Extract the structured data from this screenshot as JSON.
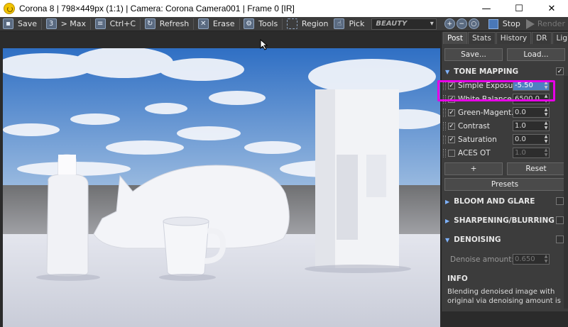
{
  "window": {
    "title": "Corona 8 | 798×449px (1:1) | Camera: Corona Camera001 | Frame 0 [IR]",
    "minimize": "—",
    "maximize": "☐",
    "close": "✕"
  },
  "toolbar": {
    "save": "Save",
    "max": "> Max",
    "copy": "Ctrl+C",
    "refresh": "Refresh",
    "erase": "Erase",
    "tools": "Tools",
    "region": "Region",
    "pick": "Pick",
    "channel": "BEAUTY",
    "stop": "Stop",
    "render": "Render"
  },
  "tabs": [
    "Post",
    "Stats",
    "History",
    "DR",
    "LightMix"
  ],
  "panel": {
    "save": "Save...",
    "load": "Load...",
    "tone_mapping": "TONE MAPPING",
    "rows": [
      {
        "label": "Simple Exposure",
        "value": "-5.50"
      },
      {
        "label": "White Balance",
        "value": "6500.0"
      },
      {
        "label": "Green-Magent...",
        "value": "0.0"
      },
      {
        "label": "Contrast",
        "value": "1.0"
      },
      {
        "label": "Saturation",
        "value": "0.0"
      },
      {
        "label": "ACES OT",
        "value": "1.0"
      }
    ],
    "plus": "+",
    "reset": "Reset",
    "presets": "Presets",
    "bloom": "BLOOM AND GLARE",
    "sharpen": "SHARPENING/BLURRING",
    "denoising": "DENOISING",
    "denoise_label": "Denoise amount:",
    "denoise_value": "0.650",
    "info": "INFO",
    "info_text": "Blending denoised image with original via denoising amount is"
  },
  "colors": {
    "highlight": "#e600e6",
    "accent": "#4f7fc1",
    "sky": "#3f78c9"
  }
}
